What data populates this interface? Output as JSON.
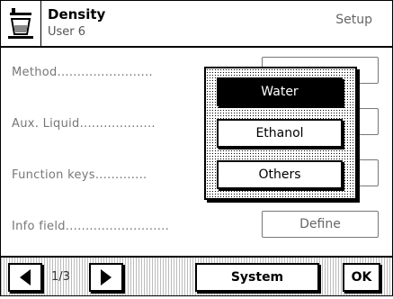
{
  "header": {
    "title": "Density",
    "user": "User 6",
    "mode": "Setup",
    "icon": "balance-icon"
  },
  "rows": [
    {
      "label": "Method........................",
      "value": ""
    },
    {
      "label": "Aux. Liquid...................",
      "value": ""
    },
    {
      "label": "Function keys.............",
      "value": ""
    },
    {
      "label": "Info field..........................",
      "value": "Define"
    }
  ],
  "dropdown": {
    "options": [
      "Water",
      "Ethanol",
      "Others"
    ],
    "selected": "Water"
  },
  "footer": {
    "page": "1/3",
    "system_label": "System",
    "ok_label": "OK",
    "prev_icon": "arrow-left-icon",
    "next_icon": "arrow-right-icon"
  }
}
